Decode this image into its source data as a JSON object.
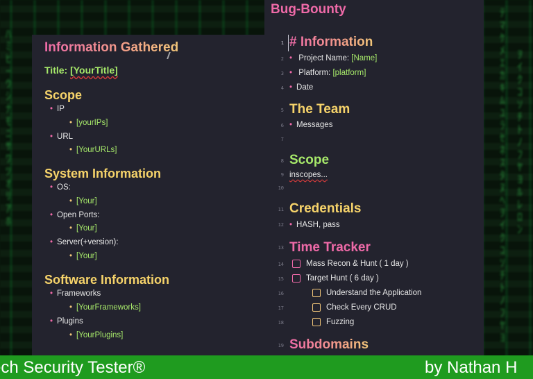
{
  "left": {
    "heading": "Information Gathered",
    "title_label": "Title:",
    "title_value": "[YourTitle]",
    "scope": {
      "heading": "Scope",
      "items": [
        {
          "label": "IP",
          "sub": "[yourIPs]"
        },
        {
          "label": "URL",
          "sub": "[YourURLs]"
        }
      ]
    },
    "system": {
      "heading": "System Information",
      "items": [
        {
          "label": "OS:",
          "sub": "[Your]"
        },
        {
          "label": "Open Ports:",
          "sub": "[Your]"
        },
        {
          "label": "Server(+version):",
          "sub": "[Your]"
        }
      ]
    },
    "software": {
      "heading": "Software Information",
      "items": [
        {
          "label": "Frameworks",
          "sub": "[YourFrameworks]"
        },
        {
          "label": "Plugins",
          "sub": "[YourPlugins]"
        }
      ]
    }
  },
  "right": {
    "doc_title": "Bug-Bounty",
    "line_numbers": [
      "1",
      "2",
      "3",
      "4",
      "5",
      "6",
      "7",
      "8",
      "9",
      "10",
      "11",
      "12",
      "13",
      "14",
      "15",
      "16",
      "17",
      "18",
      "19"
    ],
    "information_heading": "# Information",
    "project_label": "Project Name:",
    "project_value": "[Name]",
    "platform_label": "Platform:",
    "platform_value": "[platform]",
    "date_label": "Date",
    "team_heading": "The Team",
    "messages_label": "Messages",
    "scope_heading": "Scope",
    "inscopes_text": "inscopes...",
    "credentials_heading": "Credentials",
    "hash_text": "HASH, pass",
    "time_tracker_heading": "Time Tracker",
    "tasks": [
      {
        "label": "Mass Recon & Hunt ( 1 day )"
      },
      {
        "label": "Target Hunt ( 6 day )"
      },
      {
        "label": "Understand the Application"
      },
      {
        "label": "Check Every CRUD"
      },
      {
        "label": "Fuzzing"
      }
    ],
    "subdomains_heading": "Subdomains"
  },
  "banner": {
    "left_text": "ech Security Tester®",
    "right_text": "by Nathan H"
  }
}
